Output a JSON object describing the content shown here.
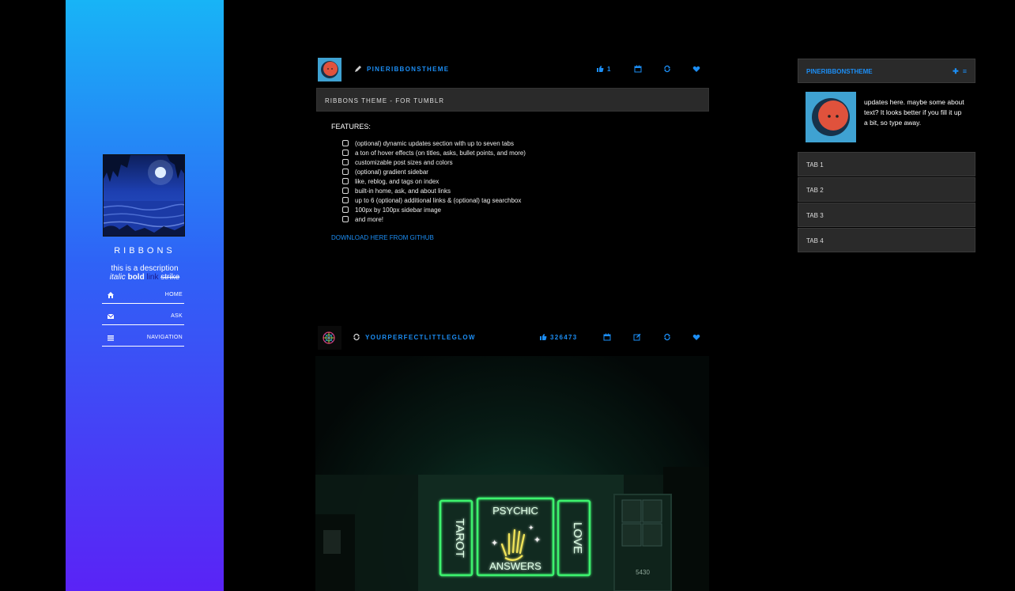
{
  "sidebar": {
    "title": "RIBBONS",
    "description": "this is a description",
    "desc_italic": "italic",
    "desc_bold": "bold",
    "desc_link": "link",
    "desc_strike": "strike",
    "nav": [
      {
        "label": "HOME",
        "icon": "home-icon"
      },
      {
        "label": "ASK",
        "icon": "envelope-icon"
      },
      {
        "label": "NAVIGATION",
        "icon": "menu-icon"
      }
    ]
  },
  "post1": {
    "username": "PINERIBBONSTHEME",
    "likes": "1",
    "title": "RIBBONS THEME - FOR TUMBLR",
    "features_heading": "FEATURES:",
    "features": [
      "(optional) dynamic updates section with up to seven tabs",
      "a ton of hover effects (on titles, asks, bullet points, and more)",
      "customizable post sizes and colors",
      "(optional) gradient sidebar",
      "like, reblog, and tags on index",
      "built-in home, ask, and about links",
      "up to 6 (optional) additional links & (optional) tag searchbox",
      "100px by 100px sidebar image",
      "and more!"
    ],
    "download_link": "DOWNLOAD HERE FROM GITHUB"
  },
  "post2": {
    "username": "YOURPERFECTLITTLEGLOW",
    "likes": "326473",
    "sign_left": "TAROT",
    "sign_center_top": "PSYCHIC",
    "sign_center_bottom": "ANSWERS",
    "sign_right": "LOVE",
    "door_number": "5430"
  },
  "updates": {
    "username": "PINERIBBONSTHEME",
    "text": "updates here. maybe some about text? It looks better if you fill it up a bit, so type away.",
    "tabs": [
      "TAB 1",
      "TAB 2",
      "TAB 3",
      "TAB 4"
    ]
  },
  "colors": {
    "accent": "#1c8ef5",
    "panel": "#2a2a2a"
  }
}
